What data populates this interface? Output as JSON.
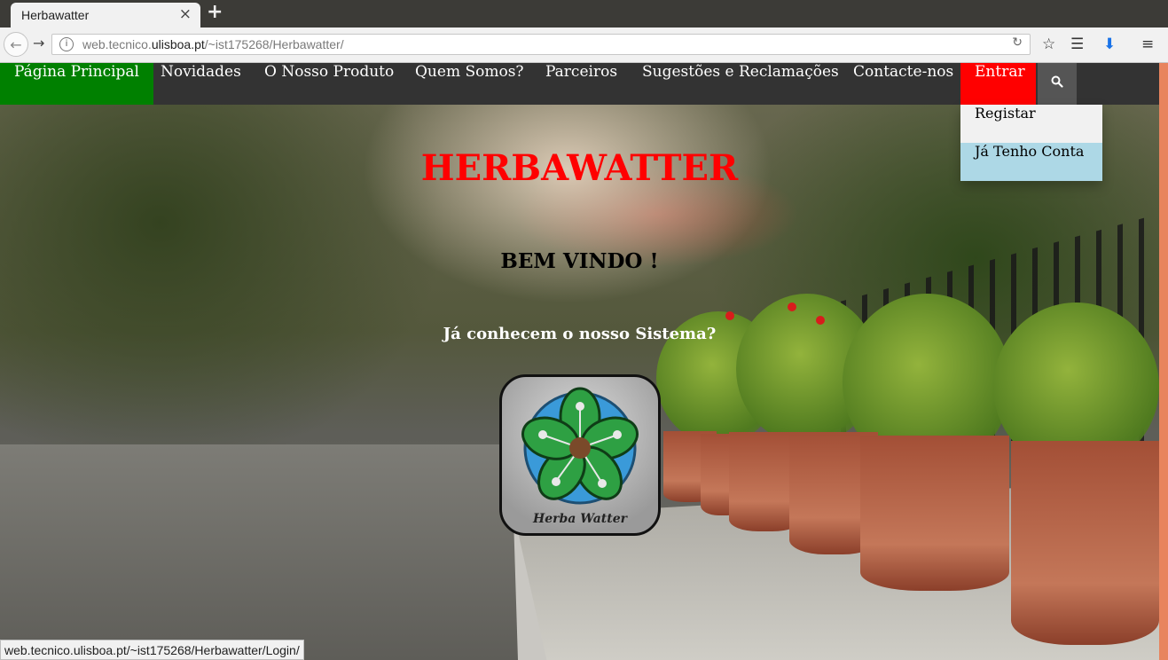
{
  "browser": {
    "tab_title": "Herbawatter",
    "tab_close": "×",
    "new_tab": "+",
    "url_prefix": "web.tecnico.",
    "url_domain": "ulisboa.pt",
    "url_suffix": "/~ist175268/Herbawatter/",
    "status_url": "web.tecnico.ulisboa.pt/~ist175268/Herbawatter/Login/"
  },
  "nav": {
    "items": [
      {
        "label": "Página Principal"
      },
      {
        "label": "Novidades"
      },
      {
        "label": "O Nosso Produto"
      },
      {
        "label": "Quem Somos?"
      },
      {
        "label": "Parceiros"
      },
      {
        "label": "Sugestões e Reclamações"
      },
      {
        "label": "Contacte-nos"
      },
      {
        "label": "Entrar"
      }
    ],
    "search_icon": "search-icon"
  },
  "dropdown": {
    "items": [
      {
        "label": "Registar"
      },
      {
        "label": "Já Tenho Conta"
      }
    ]
  },
  "hero": {
    "title": "HERBAWATTER",
    "welcome": "BEM VINDO !",
    "question": "Já conhecem o nosso Sistema?",
    "logo_text": "Herba Watter"
  },
  "colors": {
    "nav_bg": "#333333",
    "active": "#008000",
    "entrar": "#ff0000",
    "title": "#ff0000",
    "dropdown_hover": "#add8e6"
  }
}
